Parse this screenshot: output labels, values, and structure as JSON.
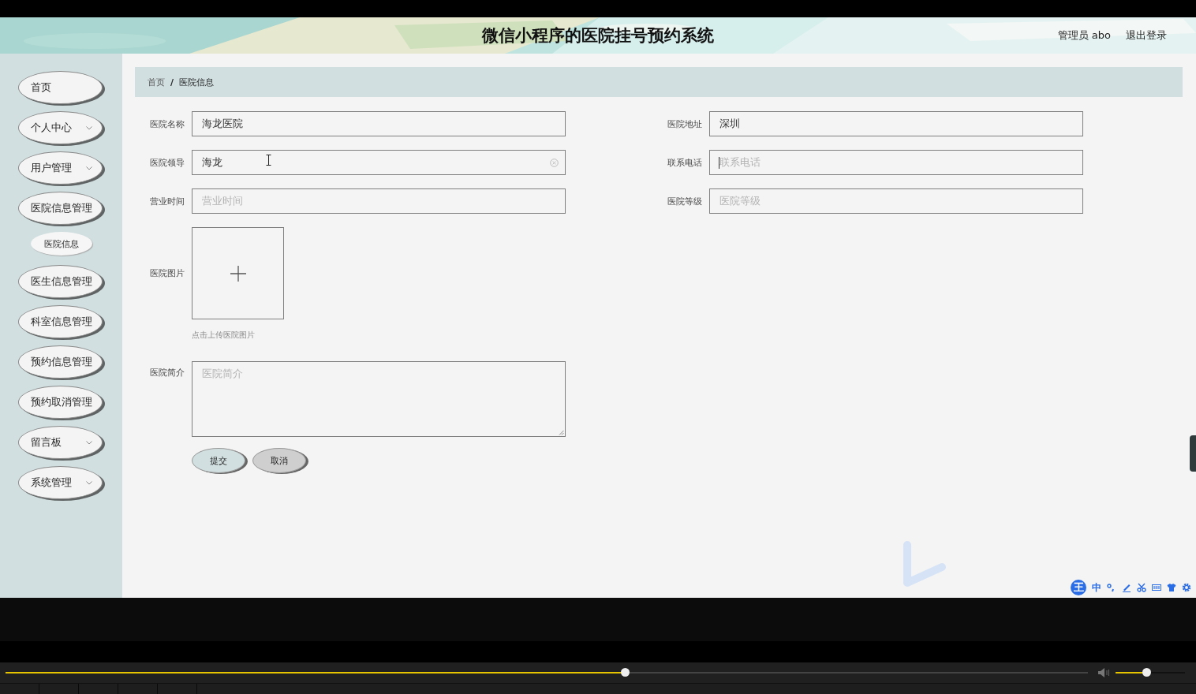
{
  "header": {
    "title": "微信小程序的医院挂号预约系统",
    "user": "管理员 abo",
    "logout": "退出登录"
  },
  "sidebar": {
    "items": [
      {
        "label": "首页",
        "chevron": false
      },
      {
        "label": "个人中心",
        "chevron": true
      },
      {
        "label": "用户管理",
        "chevron": true
      },
      {
        "label": "医院信息管理",
        "chevron": false,
        "children": [
          {
            "label": "医院信息"
          }
        ]
      },
      {
        "label": "医生信息管理",
        "chevron": false
      },
      {
        "label": "科室信息管理",
        "chevron": false
      },
      {
        "label": "预约信息管理",
        "chevron": false
      },
      {
        "label": "预约取消管理",
        "chevron": false
      },
      {
        "label": "留言板",
        "chevron": true
      },
      {
        "label": "系统管理",
        "chevron": true
      }
    ]
  },
  "breadcrumb": {
    "items": [
      "首页",
      "医院信息"
    ],
    "separator": "/"
  },
  "form": {
    "rows": [
      [
        {
          "kind": "input",
          "label": "医院名称",
          "value": "海龙医院",
          "focused": false,
          "clearable": false
        },
        {
          "kind": "input",
          "label": "医院地址",
          "value": "深圳",
          "focused": false,
          "clearable": false
        }
      ],
      [
        {
          "kind": "input",
          "label": "医院领导",
          "value": "海龙",
          "focused": false,
          "clearable": true
        },
        {
          "kind": "input",
          "label": "联系电话",
          "placeholder": "联系电话",
          "focused": true,
          "clearable": false
        }
      ],
      [
        {
          "kind": "input",
          "label": "营业时间",
          "placeholder": "营业时间",
          "focused": false,
          "clearable": false
        },
        {
          "kind": "input",
          "label": "医院等级",
          "placeholder": "医院等级",
          "focused": false,
          "clearable": false
        }
      ],
      [
        {
          "kind": "upload",
          "label": "医院图片",
          "hint": "点击上传医院图片"
        }
      ],
      [
        {
          "kind": "textarea",
          "label": "医院简介",
          "placeholder": "医院简介"
        }
      ]
    ],
    "buttons": [
      {
        "label": "提交",
        "kind": "primary"
      },
      {
        "label": "取消",
        "kind": "secondary"
      }
    ]
  },
  "ime": {
    "logo": "王",
    "mode": "中"
  },
  "player": {
    "progress": {
      "level": 0.572
    },
    "volume": {
      "level": 0.44
    }
  }
}
